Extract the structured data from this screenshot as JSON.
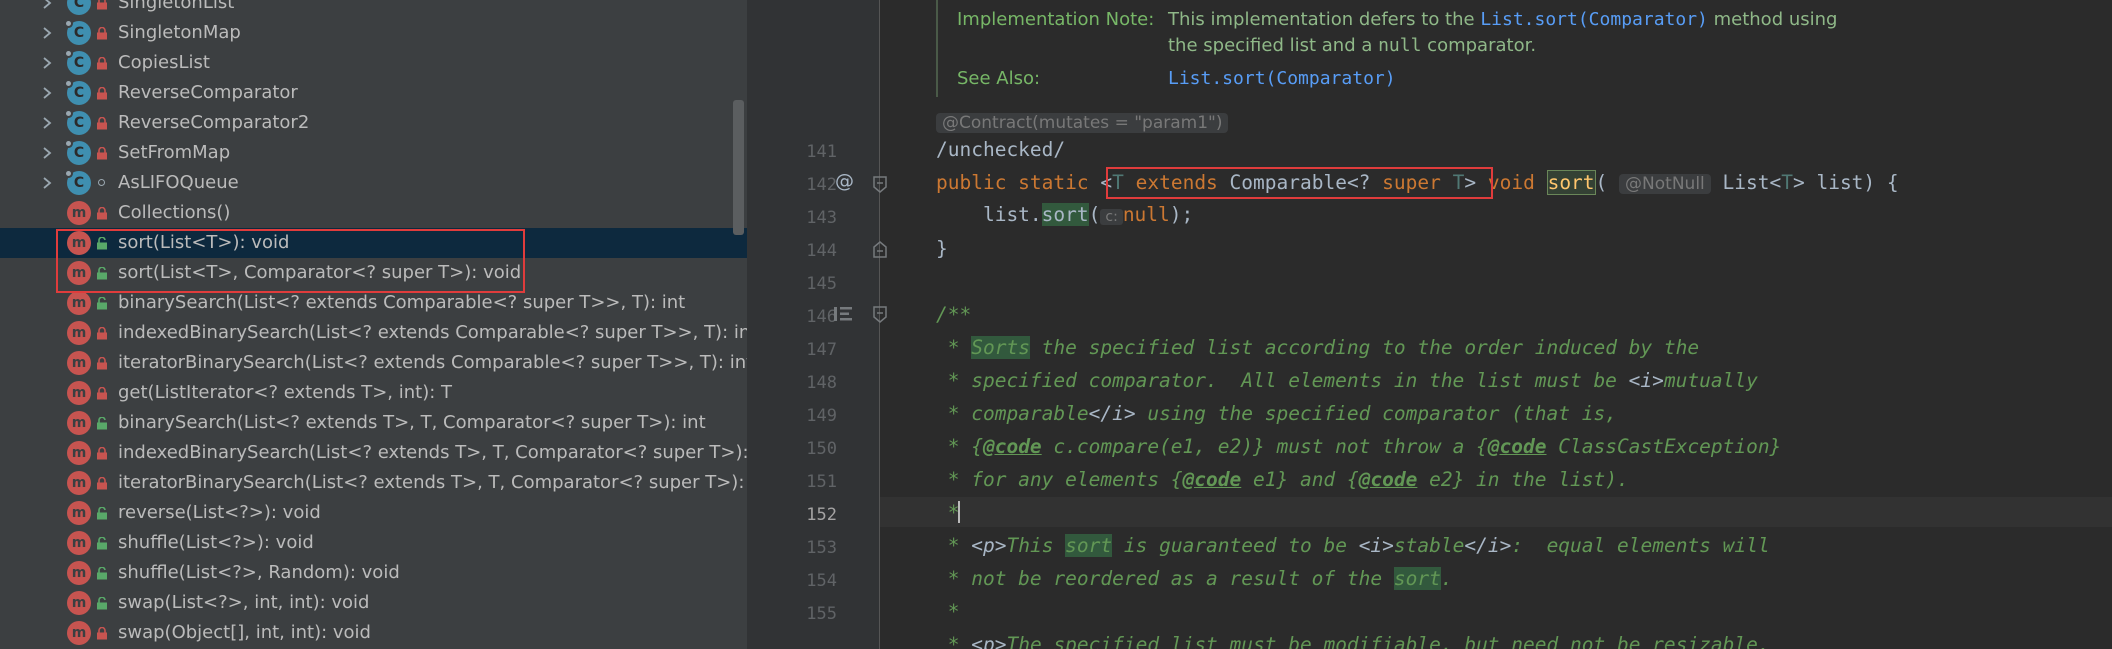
{
  "structure": {
    "items": [
      {
        "label": "SingletonList",
        "kind": "class",
        "access": "private",
        "expandable": true
      },
      {
        "label": "SingletonMap",
        "kind": "class",
        "access": "private",
        "expandable": true
      },
      {
        "label": "CopiesList",
        "kind": "class",
        "access": "private",
        "expandable": true
      },
      {
        "label": "ReverseComparator",
        "kind": "class",
        "access": "private",
        "expandable": true
      },
      {
        "label": "ReverseComparator2",
        "kind": "class",
        "access": "private",
        "expandable": true
      },
      {
        "label": "SetFromMap",
        "kind": "class",
        "access": "private",
        "expandable": true
      },
      {
        "label": "AsLIFOQueue",
        "kind": "class",
        "access": "package",
        "expandable": true
      },
      {
        "label": "Collections()",
        "kind": "method",
        "access": "private",
        "expandable": false
      },
      {
        "label": "sort(List<T>): void",
        "kind": "method",
        "access": "public",
        "expandable": false
      },
      {
        "label": "sort(List<T>, Comparator<? super T>): void",
        "kind": "method",
        "access": "public",
        "expandable": false
      },
      {
        "label": "binarySearch(List<? extends Comparable<? super T>>, T): int",
        "kind": "method",
        "access": "public",
        "expandable": false
      },
      {
        "label": "indexedBinarySearch(List<? extends Comparable<? super T>>, T): int",
        "kind": "method",
        "access": "private",
        "expandable": false
      },
      {
        "label": "iteratorBinarySearch(List<? extends Comparable<? super T>>, T): int",
        "kind": "method",
        "access": "private",
        "expandable": false
      },
      {
        "label": "get(ListIterator<? extends T>, int): T",
        "kind": "method",
        "access": "private",
        "expandable": false
      },
      {
        "label": "binarySearch(List<? extends T>, T, Comparator<? super T>): int",
        "kind": "method",
        "access": "public",
        "expandable": false
      },
      {
        "label": "indexedBinarySearch(List<? extends T>, T, Comparator<? super T>): int",
        "kind": "method",
        "access": "private",
        "expandable": false
      },
      {
        "label": "iteratorBinarySearch(List<? extends T>, T, Comparator<? super T>): int",
        "kind": "method",
        "access": "private",
        "expandable": false
      },
      {
        "label": "reverse(List<?>): void",
        "kind": "method",
        "access": "public",
        "expandable": false
      },
      {
        "label": "shuffle(List<?>): void",
        "kind": "method",
        "access": "public",
        "expandable": false
      },
      {
        "label": "shuffle(List<?>, Random): void",
        "kind": "method",
        "access": "public",
        "expandable": false
      },
      {
        "label": "swap(List<?>, int, int): void",
        "kind": "method",
        "access": "public",
        "expandable": false
      },
      {
        "label": "swap(Object[], int, int): void",
        "kind": "method",
        "access": "private",
        "expandable": false
      }
    ],
    "selected_index": 8
  },
  "doc": {
    "impl_label": "Implementation Note:",
    "impl_text1": "This implementation defers to the ",
    "impl_link": "List.sort(Comparator)",
    "impl_text2": " method using",
    "impl_line2a": "the specified list and a ",
    "impl_null": "null",
    "impl_line2b": " comparator.",
    "see_label": "See Also:",
    "see_link": "List.sort(Comparator)"
  },
  "editor": {
    "annotation_pill": "@Contract(mutates = \"param1\")",
    "unchecked": "/unchecked/",
    "line_numbers": [
      "141",
      "142",
      "143",
      "144",
      "145",
      "146",
      "147",
      "148",
      "149",
      "150",
      "151",
      "152",
      "153",
      "154",
      "155"
    ],
    "current_line": "152",
    "code": {
      "l142_kw": "public static ",
      "l142_lt": "<",
      "l142_T": "T",
      "l142_ext": " extends ",
      "l142_cmp": "Comparable<? ",
      "l142_super": "super ",
      "l142_T2": "T",
      "l142_gt": ">",
      "l142_void": " void ",
      "l142_fn": "sort",
      "l142_paren": "(",
      "l142_notnull": "@NotNull",
      "l142_list": " List<",
      "l142_T3": "T",
      "l142_rest": "> list) {",
      "l143_indent": "    list.",
      "l143_fn": "sort",
      "l143_paren": "(",
      "l143_hint": "c:",
      "l143_null": "null",
      "l143_end": ");",
      "l144": "}",
      "l146": "/**",
      "l147a": " * ",
      "l147b": "Sorts",
      "l147c": " the specified list according to the order induced by the",
      "l148a": " * specified comparator.  All elements in the list must be ",
      "l148b": "<i>",
      "l148c": "mutually",
      "l149a": " * comparable",
      "l149b": "</i>",
      "l149c": " using the specified comparator (that is,",
      "l150a": " * {",
      "l150b": "@code",
      "l150c": " c.compare(e1, e2)} must not throw a {",
      "l150d": "@code",
      "l150e": " ClassCastException}",
      "l151a": " * for any elements {",
      "l151b": "@code",
      "l151c": " e1} and {",
      "l151d": "@code",
      "l151e": " e2} in the list).",
      "l152": " *",
      "l153a": " * ",
      "l153b": "<p>",
      "l153c": "This ",
      "l153d": "sort",
      "l153e": " is guaranteed to be ",
      "l153f": "<i>",
      "l153g": "stable",
      "l153h": "</i>",
      "l153i": ":  equal elements will",
      "l154a": " * not be reordered as a result of the ",
      "l154b": "sort",
      "l154c": ".",
      "l155": " *",
      "l156a": " * ",
      "l156b": "<p>",
      "l156c": "The specified list must be modifiable, but need not be resizable."
    }
  },
  "colors": {
    "structure_bg": "#3c3f41",
    "editor_bg": "#2b2b2b",
    "selection": "#0d293e",
    "highlight_box": "#e03c3c",
    "keyword": "#cc7832",
    "doc_comment": "#629755"
  }
}
